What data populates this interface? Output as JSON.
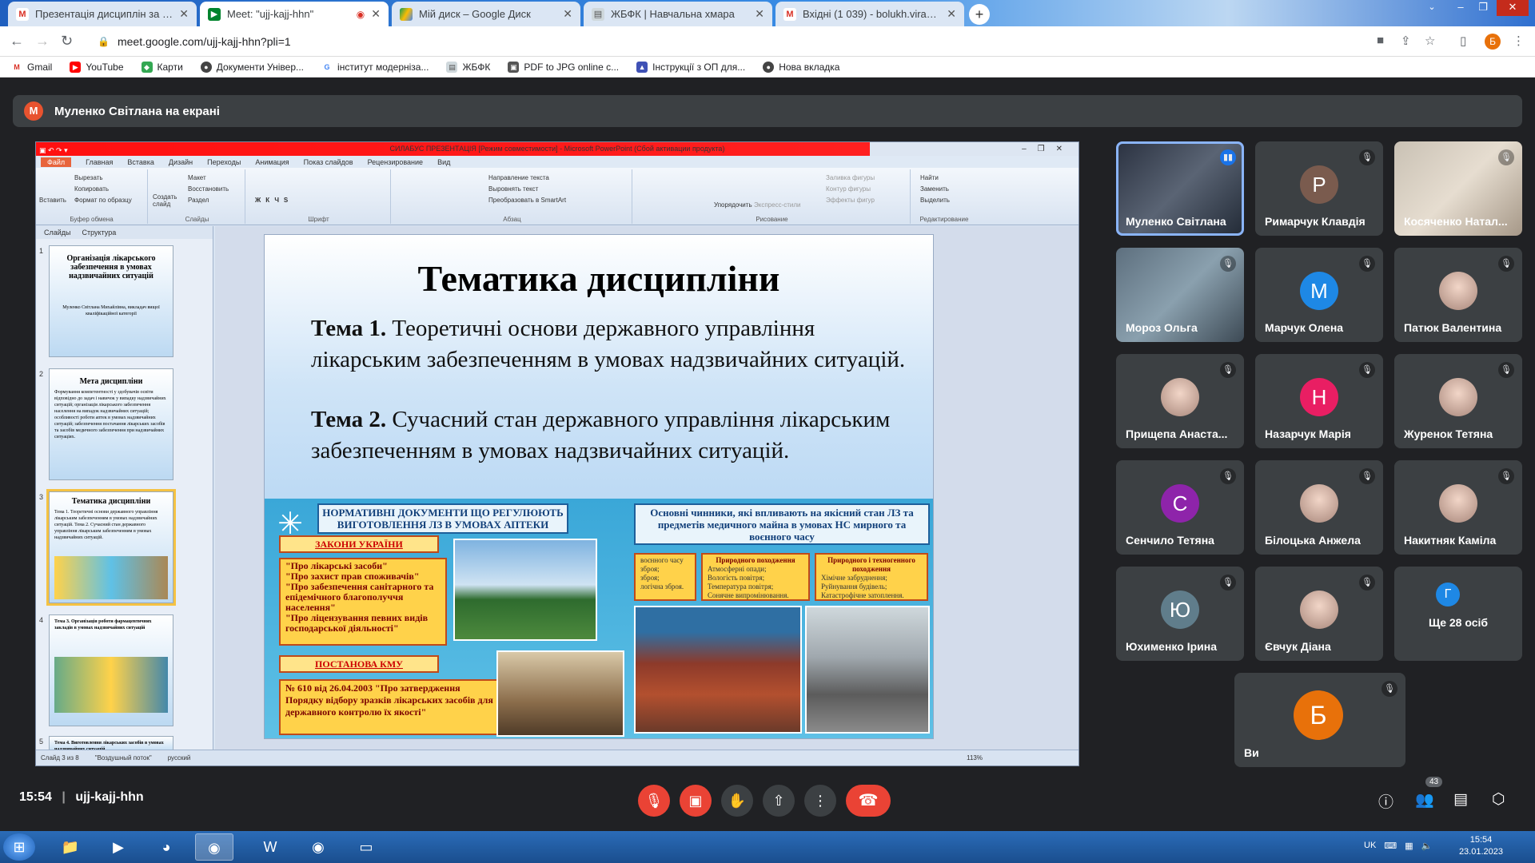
{
  "browser": {
    "tabs": [
      {
        "title": "Презентація дисциплін за вибо…",
        "favicon": "gmail-icon",
        "active": false
      },
      {
        "title": "Meet: \"ujj-kajj-hhn\"",
        "favicon": "meet-icon",
        "active": true
      },
      {
        "title": "Мій диск – Google Диск",
        "favicon": "drive-icon",
        "active": false
      },
      {
        "title": "ЖБФК | Навчальна хмара",
        "favicon": "cloud-icon",
        "active": false
      },
      {
        "title": "Вхідні (1 039) - bolukh.vira@pha…",
        "favicon": "gmail-icon",
        "active": false
      }
    ],
    "url": "meet.google.com/ujj-kajj-hhn?pli=1",
    "profile_initial": "Б",
    "bookmarks": [
      "Gmail",
      "YouTube",
      "Карти",
      "Документи Універ...",
      "інститут модерніза...",
      "ЖБФК",
      "PDF to JPG online c...",
      "Інструкції з ОП для...",
      "Нова вкладка"
    ]
  },
  "meet": {
    "presenter_initial": "М",
    "presenter_banner": "Муленко Світлана на екрані",
    "meeting_time": "15:54",
    "meeting_code": "ujj-kajj-hhn",
    "participants_count": "43",
    "participants": [
      {
        "name": "Муленко Світлана",
        "initial": "",
        "color": "",
        "speaking": true
      },
      {
        "name": "Римарчук Клавдія",
        "initial": "Р",
        "color": "#7a5b4e"
      },
      {
        "name": "Косяченко Натал...",
        "initial": "",
        "color": ""
      },
      {
        "name": "Мороз Ольга",
        "initial": "",
        "color": ""
      },
      {
        "name": "Марчук Олена",
        "initial": "М",
        "color": "#1e88e5"
      },
      {
        "name": "Патюк Валентина",
        "initial": "",
        "color": ""
      },
      {
        "name": "Прищепа Анаста...",
        "initial": "",
        "color": ""
      },
      {
        "name": "Назарчук Марія",
        "initial": "Н",
        "color": "#e91e63"
      },
      {
        "name": "Журенок Тетяна",
        "initial": "",
        "color": ""
      },
      {
        "name": "Сенчило Тетяна",
        "initial": "С",
        "color": "#8e24aa"
      },
      {
        "name": "Білоцька Анжела",
        "initial": "",
        "color": ""
      },
      {
        "name": "Накитняк Каміла",
        "initial": "",
        "color": ""
      },
      {
        "name": "Юхименко Ірина",
        "initial": "Ю",
        "color": "#607d8b"
      },
      {
        "name": "Євчук Діана",
        "initial": "",
        "color": ""
      },
      {
        "name": "Ще 28 осіб",
        "initial": "Г",
        "color": "#1e88e5"
      },
      {
        "name": "Ви",
        "initial": "Б",
        "color": "#e8710a"
      }
    ]
  },
  "ppt": {
    "window_title": "СИЛАБУС ПРЕЗЕНТАЦІЯ [Режим совместимости] - Microsoft PowerPoint (Сбой активации продукта)",
    "tabs": [
      "Файл",
      "Главная",
      "Вставка",
      "Дизайн",
      "Переходы",
      "Анимация",
      "Показ слайдов",
      "Рецензирование",
      "Вид"
    ],
    "ribbon_groups": [
      "Буфер обмена",
      "Слайды",
      "Шрифт",
      "Абзац",
      "Рисование",
      "Редактирование"
    ],
    "ribbon_items": {
      "paste": "Вставить",
      "cut": "Вырезать",
      "copy": "Копировать",
      "format_painter": "Формат по образцу",
      "create_slide": "Создать слайд",
      "layout": "Макет",
      "restore": "Восстановить",
      "section": "Раздел",
      "text_direction": "Направление текста",
      "align_text": "Выровнять текст",
      "smartart": "Преобразовать в SmartArt",
      "arrange": "Упорядочить",
      "quick_styles": "Экспресс-стили",
      "fill": "Заливка фигуры",
      "outline": "Контур фигуры",
      "effects": "Эффекты фигур",
      "find": "Найти",
      "replace": "Заменить",
      "select": "Выделить"
    },
    "panel_tabs": [
      "Слайды",
      "Структура"
    ],
    "thumbnails": [
      {
        "num": "1",
        "title": "Організація лікарського забезпечення в умовах надзвичайних ситуацій",
        "body": "Муленко Світлана Михайлівна, викладач вищої кваліфікаційної категорії"
      },
      {
        "num": "2",
        "title": "Мета дисципліни",
        "body": "Формування компетентності у здобувачів освіти відповідно до задач і навичок у випадку надзвичайних ситуацій; організація лікарського забезпечення населення на випадок надзвичайних ситуацій; особливості роботи аптек в умовах надзвичайних ситуацій; забезпечення постачання лікарських засобів та засобів медичного забезпечення при надзвичайних ситуаціях."
      },
      {
        "num": "3",
        "title": "Тематика дисципліни",
        "body": "Тема 1. Теоретичні основи державного управління лікарським забезпеченням в умовах надзвичайних ситуацій. Тема 2. Сучасний стан державного управління лікарським забезпеченням в умовах надзвичайних ситуацій."
      },
      {
        "num": "4",
        "title": "",
        "body": "Тема 3. Організація роботи фармацевтичних закладів в умовах надзвичайних ситуацій"
      },
      {
        "num": "5",
        "title": "",
        "body": "Тема 4. Виготовлення лікарських засобів в умовах надзвичайних ситуацій"
      }
    ],
    "status": [
      "Слайд 3 из 8",
      "\"Воздушный поток\"",
      "русский"
    ],
    "zoom": "113%"
  },
  "slide": {
    "title": "Тематика дисципліни",
    "topic1_label": "Тема 1.",
    "topic1_text": " Теоретичні основи державного управління лікарським забезпеченням в умовах надзвичайних ситуацій.",
    "topic2_label": "Тема 2.",
    "topic2_text": " Сучасний стан державного управління лікарським забезпеченням в умовах надзвичайних ситуацій.",
    "box_norm": "НОРМАТИВНІ ДОКУМЕНТИ ЩО РЕГУЛЮЮТЬ ВИГОТОВЛЕННЯ ЛЗ В УМОВАХ АПТЕКИ",
    "box_factors": "Основні чинники, які впливають на якісний стан ЛЗ та предметів медичного майна в умовах НС мирного та воєнного часу",
    "laws_title": "ЗАКОНИ УКРАЇНИ",
    "laws": [
      "\"Про лікарські засоби\"",
      "\"Про захист прав споживачів\"",
      "\"Про забезпечення санітарного та епідемічного благополуччя населення\"",
      "\"Про ліцензування певних видів господарської діяльності\""
    ],
    "decree_title": "ПОСТАНОВА КМУ",
    "decree_text": "№ 610 від 26.04.2003 \"Про затвердження Порядку відбору зразків лікарських засобів для державного контролю їх якості\"",
    "factor1": [
      "воєнного часу",
      "зброя;",
      "зброя;",
      "логічна зброя."
    ],
    "factor2_title": "Природного походження",
    "factor2": [
      "Атмосферні опади;",
      "Вологість повітря;",
      "Температура повітря;",
      "Сонячне випромінювання."
    ],
    "factor3_title": "Природного і техногенного походження",
    "factor3": [
      "Хімічне забруднення;",
      "Руйнування будівель;",
      "Катастрофічне затоплення."
    ]
  },
  "taskbar": {
    "lang": "UK",
    "time": "15:54",
    "date": "23.01.2023"
  }
}
